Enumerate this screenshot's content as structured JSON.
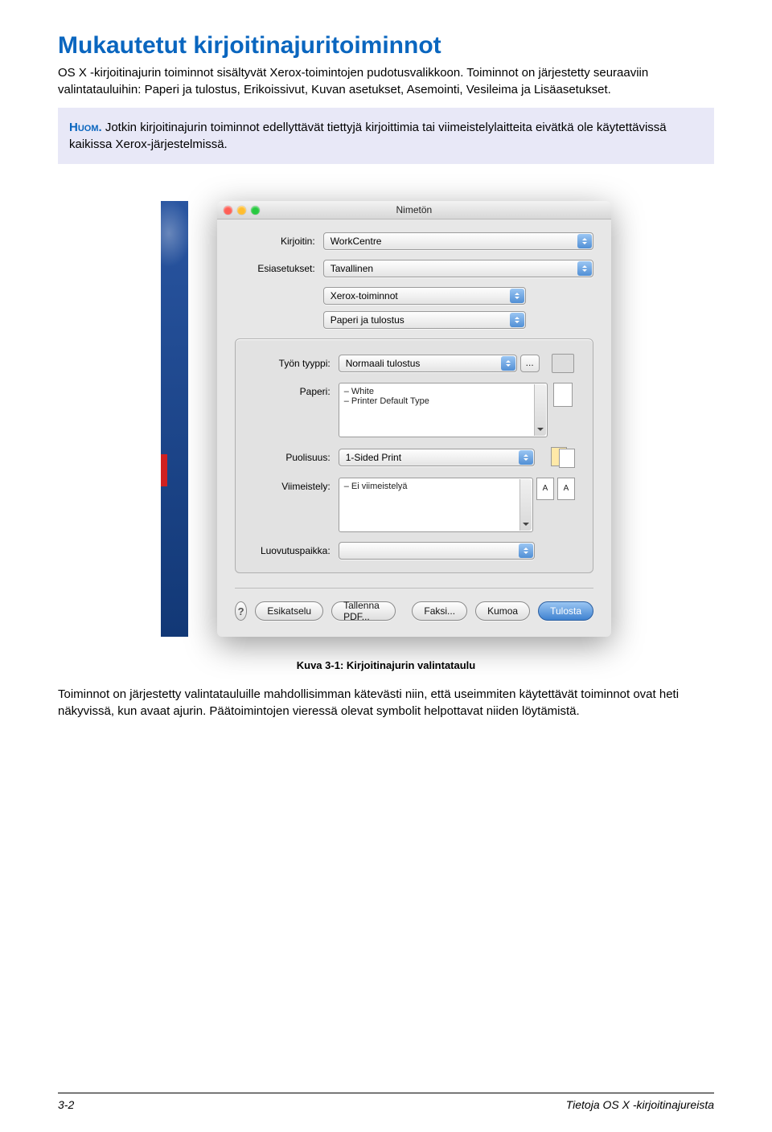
{
  "heading": "Mukautetut kirjoitinajuritoiminnot",
  "intro": "OS X -kirjoitinajurin toiminnot sisältyvät Xerox-toimintojen pudotusvalikkoon. Toiminnot on järjestetty seuraaviin valintatauluihin: Paperi ja tulostus, Erikoissivut, Kuvan asetukset, Asemointi, Vesileima ja Lisäasetukset.",
  "note_label": "Huom.",
  "note_text": " Jotkin kirjoitinajurin toiminnot edellyttävät tiettyjä kirjoittimia tai viimeistelylaitteita eivätkä ole käytettävissä kaikissa Xerox-järjestelmissä.",
  "dialog": {
    "title": "Nimetön",
    "printer_label": "Kirjoitin:",
    "printer_value": "WorkCentre",
    "presets_label": "Esiasetukset:",
    "presets_value": "Tavallinen",
    "pane1": "Xerox-toiminnot",
    "pane2": "Paperi ja tulostus",
    "jobtype_label": "Työn tyyppi:",
    "jobtype_value": "Normaali tulostus",
    "paper_label": "Paperi:",
    "paper_line1": "– White",
    "paper_line2": "– Printer Default Type",
    "sided_label": "Puolisuus:",
    "sided_value": "1-Sided Print",
    "finish_label": "Viimeistely:",
    "finish_line1": "– Ei viimeistelyä",
    "output_label": "Luovutuspaikka:",
    "preview": "Esikatselu",
    "savepdf": "Tallenna PDF...",
    "fax": "Faksi...",
    "cancel": "Kumoa",
    "print": "Tulosta"
  },
  "caption": "Kuva 3-1: Kirjoitinajurin valintataulu",
  "para_after": "Toiminnot on järjestetty valintatauluille mahdollisimman kätevästi niin, että useimmiten käytettävät toiminnot ovat heti näkyvissä, kun avaat ajurin. Päätoimintojen vieressä olevat symbolit helpottavat niiden löytämistä.",
  "footer_left": "3-2",
  "footer_right": "Tietoja OS X -kirjoitinajureista"
}
